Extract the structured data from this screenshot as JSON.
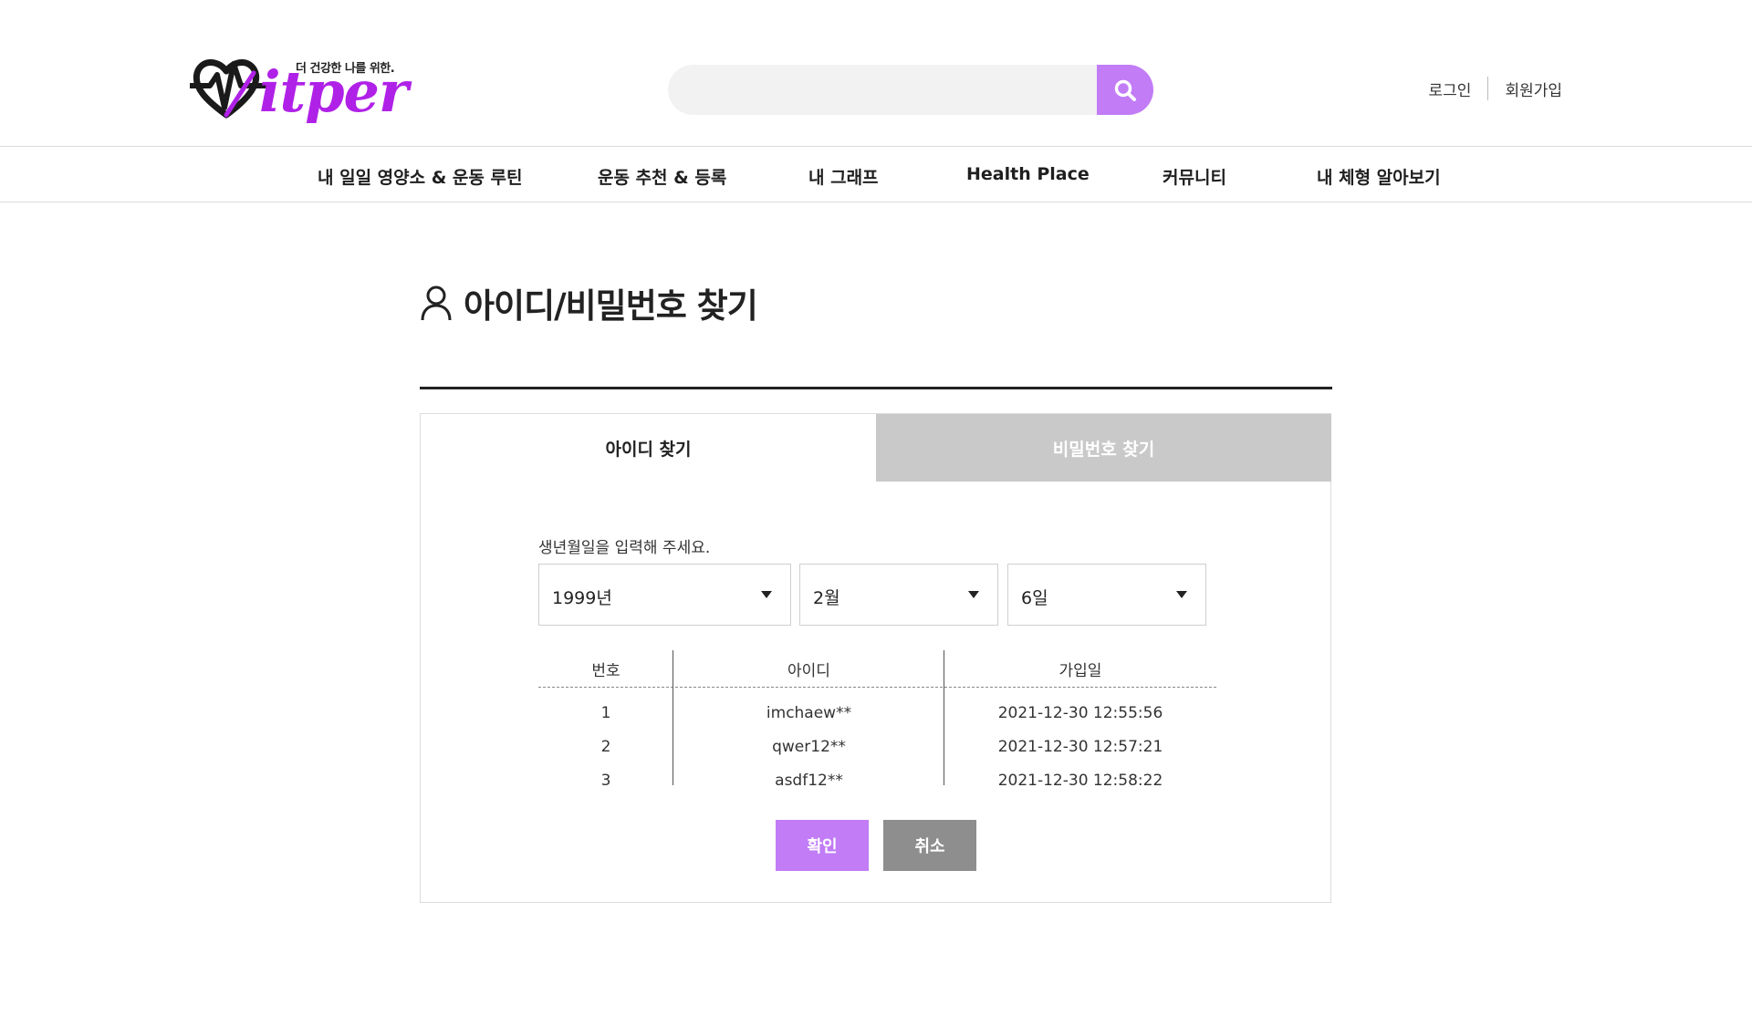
{
  "header": {
    "logo": {
      "tagline": "더 건강한 나를 위한.",
      "wordmark": "itper",
      "brand_color": "#b021e8"
    },
    "search": {
      "placeholder": "",
      "value": "",
      "icon": "search-icon",
      "button_color": "#c17cf6"
    },
    "auth": {
      "login_label": "로그인",
      "signup_label": "회원가입"
    }
  },
  "nav": {
    "items": [
      {
        "label": "내 일일 영양소 & 운동 루틴"
      },
      {
        "label": "운동 추천 & 등록"
      },
      {
        "label": "내 그래프"
      },
      {
        "label": "Health Place"
      },
      {
        "label": "커뮤니티"
      },
      {
        "label": "내 체형 알아보기"
      }
    ]
  },
  "page": {
    "title": "아이디/비밀번호 찾기",
    "title_icon": "user-icon"
  },
  "tabs": [
    {
      "label": "아이디 찾기",
      "active": true
    },
    {
      "label": "비밀번호 찾기",
      "active": false
    }
  ],
  "form": {
    "prompt": "생년월일을 입력해 주세요.",
    "year": {
      "value": "1999년"
    },
    "month": {
      "value": "2월"
    },
    "day": {
      "value": "6일"
    }
  },
  "results": {
    "headers": [
      "번호",
      "아이디",
      "가입일"
    ],
    "rows": [
      [
        "1",
        "imchaew**",
        "2021-12-30 12:55:56"
      ],
      [
        "2",
        "qwer12**",
        "2021-12-30 12:57:21"
      ],
      [
        "3",
        "asdf12**",
        "2021-12-30 12:58:22"
      ]
    ]
  },
  "buttons": {
    "confirm_label": "확인",
    "cancel_label": "취소",
    "confirm_color": "#c17cf6",
    "cancel_color": "#8e8e8e"
  }
}
